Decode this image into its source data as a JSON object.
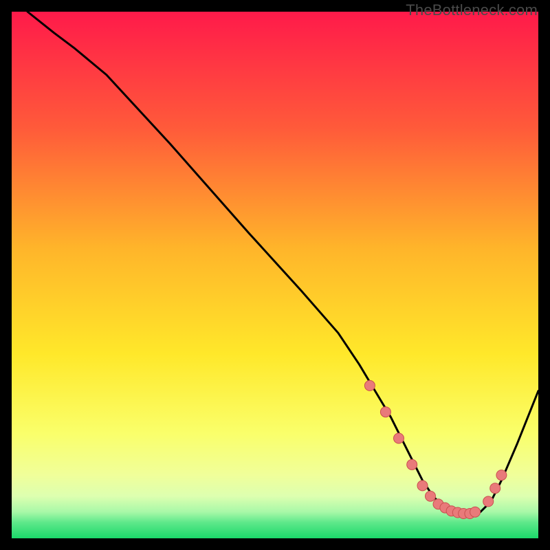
{
  "attribution": "TheBottleneck.com",
  "colors": {
    "black": "#000000",
    "curve": "#000000",
    "marker_fill": "#e97a7a",
    "marker_stroke": "#c94f4f",
    "gradient_top": "#ff1a4a",
    "gradient_mid1": "#ff9a2a",
    "gradient_mid2": "#ffe82a",
    "gradient_mid3": "#f7ff8a",
    "gradient_low": "#d9ffb0",
    "gradient_bottom": "#1bd96a"
  },
  "chart_data": {
    "type": "line",
    "title": "",
    "xlabel": "",
    "ylabel": "",
    "x_range": [
      0,
      100
    ],
    "y_range": [
      0,
      100
    ],
    "series": [
      {
        "name": "bottleneck-curve",
        "x": [
          3,
          8,
          12,
          18,
          30,
          45,
          55,
          62,
          66,
          69,
          72,
          75,
          78,
          80,
          82,
          84,
          85.5,
          87,
          89,
          91,
          93,
          96,
          100
        ],
        "y": [
          100,
          96,
          93,
          88,
          75,
          58,
          47,
          39,
          33,
          28,
          23,
          17,
          11,
          8,
          6,
          5,
          4.5,
          4.5,
          5,
          7,
          11,
          18,
          28
        ]
      }
    ],
    "markers": {
      "name": "highlighted-points",
      "x": [
        68,
        71,
        73.5,
        76,
        78,
        79.5,
        81,
        82.3,
        83.5,
        84.7,
        85.8,
        87,
        88,
        90.5,
        91.8,
        93
      ],
      "y": [
        29,
        24,
        19,
        14,
        10,
        8,
        6.5,
        5.8,
        5.2,
        4.9,
        4.7,
        4.7,
        5,
        7,
        9.5,
        12
      ]
    },
    "gradient_stops": [
      {
        "pct": 0,
        "color": "#ff1a4a"
      },
      {
        "pct": 22,
        "color": "#ff5a3a"
      },
      {
        "pct": 45,
        "color": "#ffb52a"
      },
      {
        "pct": 65,
        "color": "#ffe82a"
      },
      {
        "pct": 80,
        "color": "#faff6a"
      },
      {
        "pct": 88,
        "color": "#f0ff9a"
      },
      {
        "pct": 92,
        "color": "#ddffb0"
      },
      {
        "pct": 95,
        "color": "#a8f8a8"
      },
      {
        "pct": 97,
        "color": "#5ee88a"
      },
      {
        "pct": 100,
        "color": "#1bd96a"
      }
    ]
  }
}
